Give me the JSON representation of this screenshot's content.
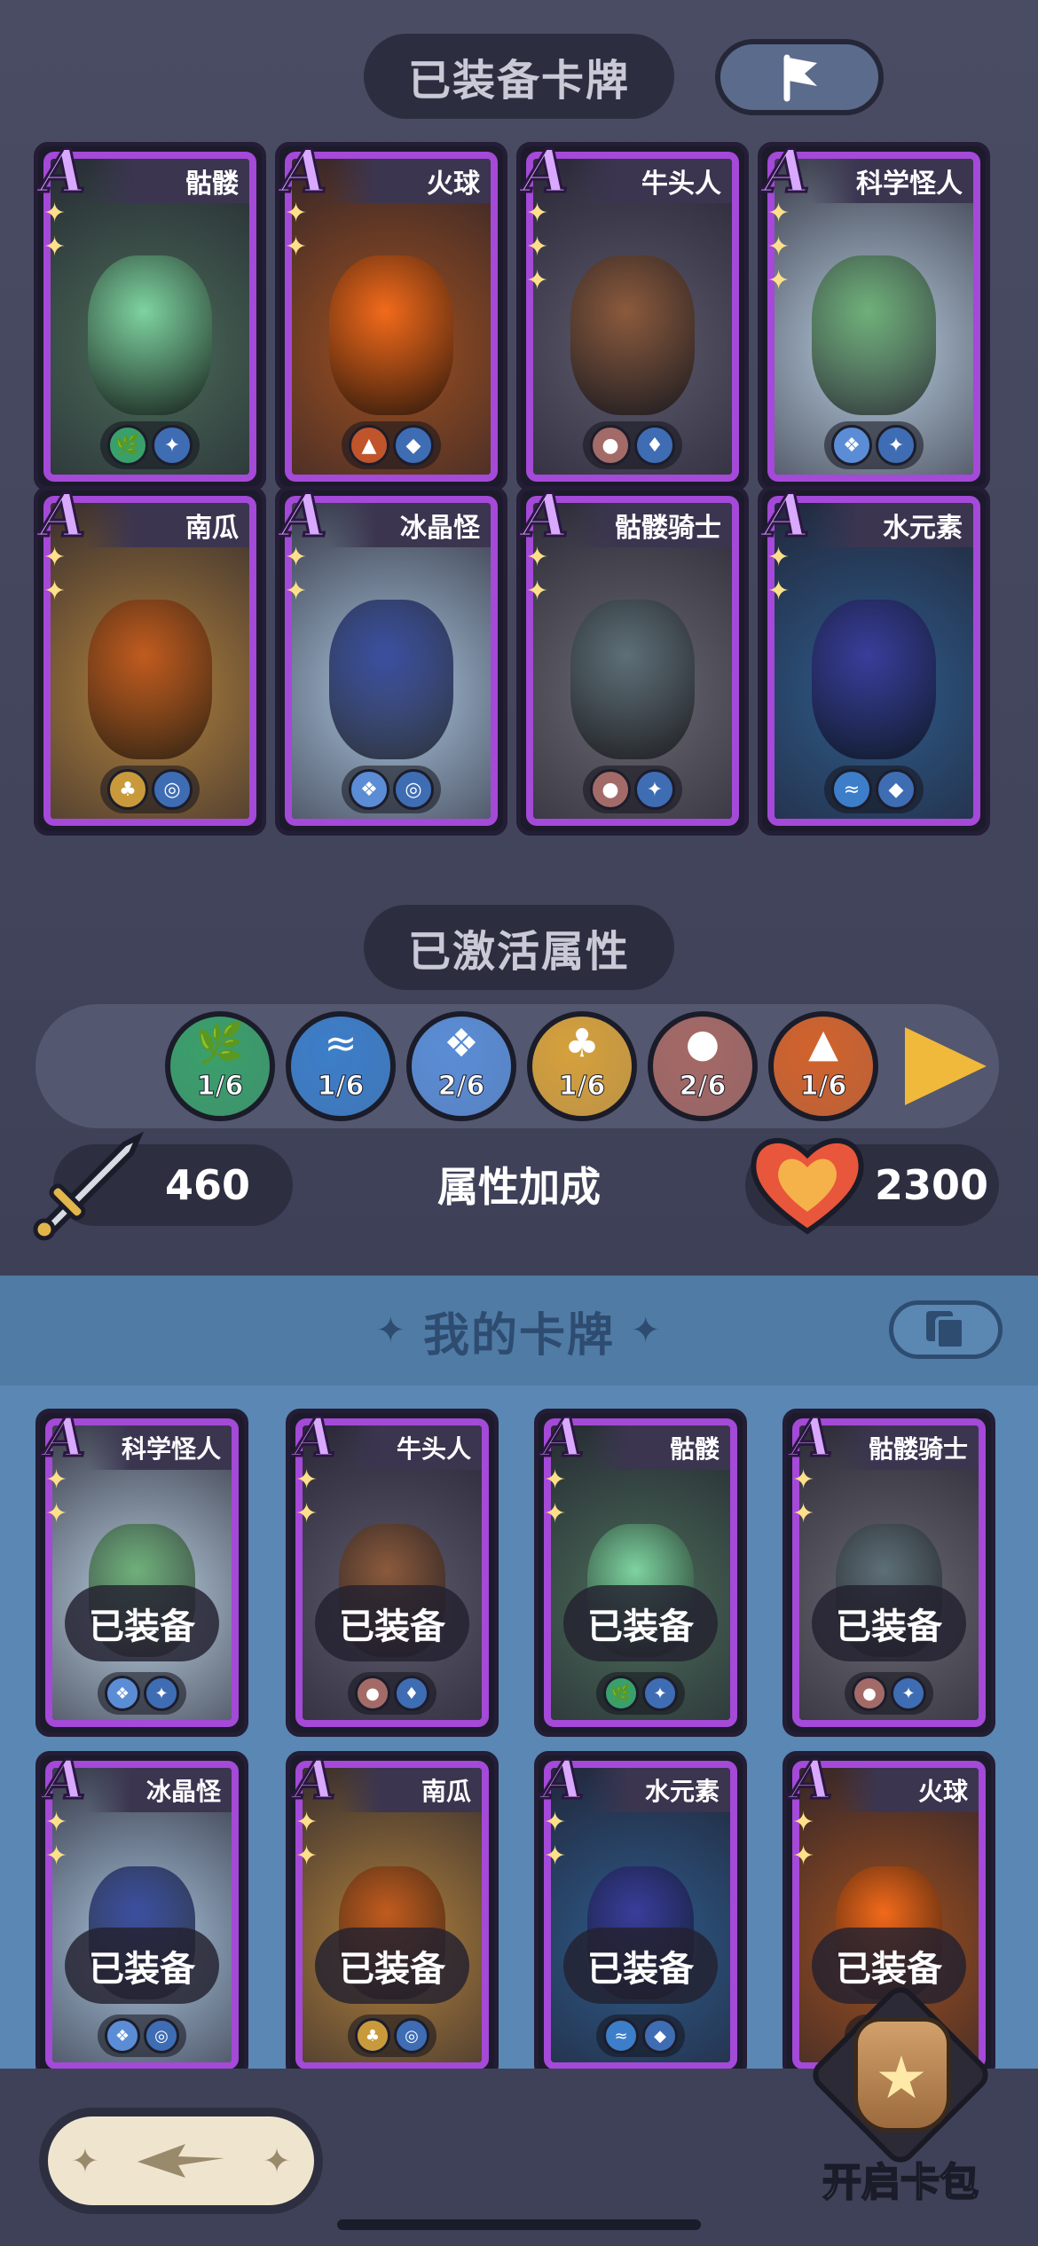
{
  "equipped_title": "已装备卡牌",
  "equipped_cards": [
    {
      "grade": "A",
      "name": "骷髅",
      "stars": 2,
      "art": "#4b6d59",
      "char": "#7ed3a0",
      "badges": [
        {
          "icon": "🌿",
          "color": "#3aa06b"
        },
        {
          "icon": "✦",
          "color": "#3e6db4"
        }
      ]
    },
    {
      "grade": "A",
      "name": "火球",
      "stars": 2,
      "art": "#a0511f",
      "char": "#f26a1b",
      "badges": [
        {
          "icon": "▲",
          "color": "#c0542a"
        },
        {
          "icon": "◆",
          "color": "#3e6db4"
        }
      ]
    },
    {
      "grade": "A",
      "name": "牛头人",
      "stars": 3,
      "art": "#5d5b6d",
      "char": "#8b5a3c",
      "badges": [
        {
          "icon": "●",
          "color": "#a36b68"
        },
        {
          "icon": "♦",
          "color": "#3e6db4"
        }
      ]
    },
    {
      "grade": "A",
      "name": "科学怪人",
      "stars": 3,
      "art": "#b9cfe0",
      "char": "#6fb07a",
      "badges": [
        {
          "icon": "❖",
          "color": "#5a8dd6"
        },
        {
          "icon": "✦",
          "color": "#3e6db4"
        }
      ]
    },
    {
      "grade": "A",
      "name": "南瓜",
      "stars": 2,
      "art": "#b2823c",
      "char": "#c15b1f",
      "badges": [
        {
          "icon": "♣",
          "color": "#c99a3c"
        },
        {
          "icon": "◎",
          "color": "#3e6db4"
        }
      ]
    },
    {
      "grade": "A",
      "name": "冰晶怪",
      "stars": 2,
      "art": "#a9c4dc",
      "char": "#3b4fa0",
      "badges": [
        {
          "icon": "❖",
          "color": "#5a8dd6"
        },
        {
          "icon": "◎",
          "color": "#3e6db4"
        }
      ]
    },
    {
      "grade": "A",
      "name": "骷髅骑士",
      "stars": 2,
      "art": "#6b6a72",
      "char": "#5d6f78",
      "badges": [
        {
          "icon": "●",
          "color": "#a36b68"
        },
        {
          "icon": "✦",
          "color": "#3e6db4"
        }
      ]
    },
    {
      "grade": "A",
      "name": "水元素",
      "stars": 2,
      "art": "#2e5c8c",
      "char": "#3a3d9b",
      "badges": [
        {
          "icon": "≈",
          "color": "#3c7ec9"
        },
        {
          "icon": "◆",
          "color": "#3e6db4"
        }
      ]
    }
  ],
  "activated_title": "已激活属性",
  "attributes": [
    {
      "icon": "🌿",
      "color": "#3aa06b",
      "count": "1/6",
      "name": "nature"
    },
    {
      "icon": "≈",
      "color": "#3c7ec9",
      "count": "1/6",
      "name": "water"
    },
    {
      "icon": "❖",
      "color": "#5a8dd6",
      "count": "2/6",
      "name": "ice"
    },
    {
      "icon": "♣",
      "color": "#d6a13c",
      "count": "1/6",
      "name": "desert"
    },
    {
      "icon": "●",
      "color": "#a56965",
      "count": "2/6",
      "name": "flesh"
    },
    {
      "icon": "▲",
      "color": "#d2632c",
      "count": "1/6",
      "name": "fire"
    }
  ],
  "stats": {
    "attack": "460",
    "bonus_label": "属性加成",
    "hp": "2300"
  },
  "my_cards_title": "我的卡牌",
  "my_cards": [
    {
      "grade": "A",
      "name": "科学怪人",
      "stars": 2,
      "art": "#b9cfe0",
      "char": "#6fb07a",
      "tag": "已装备",
      "badges": [
        {
          "icon": "❖",
          "color": "#5a8dd6"
        },
        {
          "icon": "✦",
          "color": "#3e6db4"
        }
      ]
    },
    {
      "grade": "A",
      "name": "牛头人",
      "stars": 2,
      "art": "#5d5b6d",
      "char": "#8b5a3c",
      "tag": "已装备",
      "badges": [
        {
          "icon": "●",
          "color": "#a36b68"
        },
        {
          "icon": "♦",
          "color": "#3e6db4"
        }
      ]
    },
    {
      "grade": "A",
      "name": "骷髅",
      "stars": 2,
      "art": "#4b6d59",
      "char": "#7ed3a0",
      "tag": "已装备",
      "badges": [
        {
          "icon": "🌿",
          "color": "#3aa06b"
        },
        {
          "icon": "✦",
          "color": "#3e6db4"
        }
      ]
    },
    {
      "grade": "A",
      "name": "骷髅骑士",
      "stars": 2,
      "art": "#6b6a72",
      "char": "#5d6f78",
      "tag": "已装备",
      "badges": [
        {
          "icon": "●",
          "color": "#a36b68"
        },
        {
          "icon": "✦",
          "color": "#3e6db4"
        }
      ]
    },
    {
      "grade": "A",
      "name": "冰晶怪",
      "stars": 2,
      "art": "#a9c4dc",
      "char": "#3b4fa0",
      "tag": "已装备",
      "badges": [
        {
          "icon": "❖",
          "color": "#5a8dd6"
        },
        {
          "icon": "◎",
          "color": "#3e6db4"
        }
      ]
    },
    {
      "grade": "A",
      "name": "南瓜",
      "stars": 2,
      "art": "#b2823c",
      "char": "#c15b1f",
      "tag": "已装备",
      "badges": [
        {
          "icon": "♣",
          "color": "#c99a3c"
        },
        {
          "icon": "◎",
          "color": "#3e6db4"
        }
      ]
    },
    {
      "grade": "A",
      "name": "水元素",
      "stars": 2,
      "art": "#2e5c8c",
      "char": "#3a3d9b",
      "tag": "已装备",
      "badges": [
        {
          "icon": "≈",
          "color": "#3c7ec9"
        },
        {
          "icon": "◆",
          "color": "#3e6db4"
        }
      ]
    },
    {
      "grade": "A",
      "name": "火球",
      "stars": 2,
      "art": "#a0511f",
      "char": "#f26a1b",
      "tag": "已装备",
      "badges": [
        {
          "icon": "▲",
          "color": "#c0542a"
        },
        {
          "icon": "◆",
          "color": "#3e6db4"
        }
      ]
    }
  ],
  "open_pack_label": "开启卡包"
}
